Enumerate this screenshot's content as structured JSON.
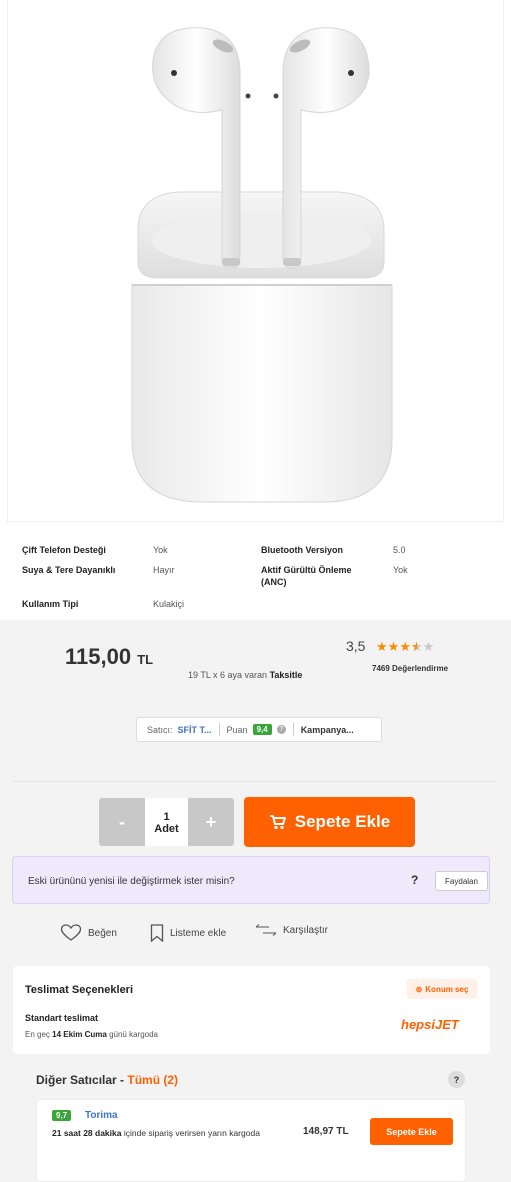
{
  "product": {
    "image_alt": "AirPods",
    "price": "115,00",
    "currency": "TL",
    "installment_prefix": "19 TL x 6 aya varan",
    "installment_bold": "Taksitle",
    "rating": "3,5",
    "rating_fraction": 0.7,
    "review_count": "7469 Değerlendirme"
  },
  "specs": [
    {
      "key": "Çift Telefon Desteği",
      "value": "Yok"
    },
    {
      "key": "Bluetooth Versiyon",
      "value": "5.0"
    },
    {
      "key": "Suya & Tere Dayanıklı",
      "value": "Hayır"
    },
    {
      "key": "Aktif Gürültü Önleme",
      "key2": "(ANC)",
      "value": "Yok"
    },
    {
      "key": "Kullanım Tipi",
      "value": "Kulakiçi"
    }
  ],
  "seller": {
    "label": "Satıcı:",
    "name": "SFİT T...",
    "score_label": "Puan",
    "score": "9,4",
    "campaign": "Kampanya..."
  },
  "cart": {
    "minus": "-",
    "plus": "+",
    "qty": "1",
    "unit": "Adet",
    "add_label": "Sepete Ekle",
    "accent": "#ff6000"
  },
  "trade_in": {
    "text": "Eski ürününü yenisi ile değiştirmek ister misin?",
    "help": "?",
    "button": "Faydalan"
  },
  "actions": {
    "like": "Beğen",
    "list": "Listeme ekle",
    "compare": "Karşılaştır"
  },
  "delivery": {
    "title": "Teslimat Seçenekleri",
    "location_btn": "Konum seç",
    "standard": "Standart teslimat",
    "eta_prefix": "En geç",
    "eta_date": "14 Ekim Cuma",
    "eta_suffix": "günü kargoda",
    "carrier_a": "hepsi",
    "carrier_b": "JET"
  },
  "other_sellers": {
    "title": "Diğer Satıcılar -",
    "all": "Tümü (2)",
    "help": "?",
    "offers": [
      {
        "score": "9,7",
        "name": "Torima",
        "time_bold": "21 saat 28 dakika",
        "time_rest": "içinde sipariş verirsen yarın kargoda",
        "price": "148,97 TL",
        "button": "Sepete Ekle"
      }
    ]
  }
}
